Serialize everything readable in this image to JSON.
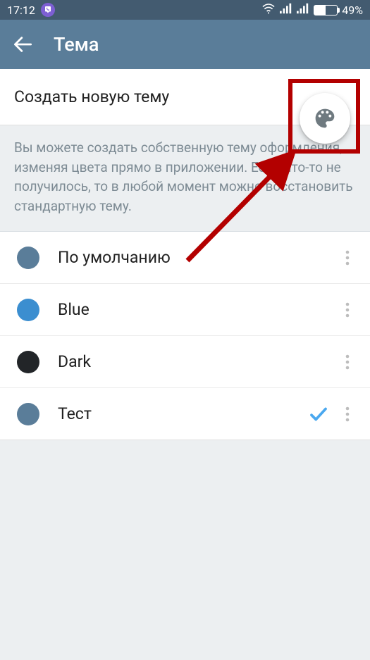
{
  "statusbar": {
    "time": "17:12",
    "battery_pct_label": "49%",
    "battery_fill_pct": 49
  },
  "appbar": {
    "title": "Тема"
  },
  "section": {
    "create_theme_label": "Создать новую тему",
    "description": "Вы можете создать собственную тему оформления, изменяя цвета прямо в приложении. Если что-то не получилось, то в любой момент можно восстановить стандартную тему."
  },
  "themes": {
    "items": [
      {
        "label": "По умолчанию",
        "swatch": "#5a7d99",
        "selected": false
      },
      {
        "label": "Blue",
        "swatch": "#3b8ed0",
        "selected": false
      },
      {
        "label": "Dark",
        "swatch": "#222528",
        "selected": false
      },
      {
        "label": "Тест",
        "swatch": "#5a7d99",
        "selected": true
      }
    ]
  },
  "colors": {
    "appbar_bg": "#5a7d99",
    "statusbar_bg": "#435b70",
    "accent_check": "#4aa8ef",
    "annotation_red": "#b30000"
  }
}
